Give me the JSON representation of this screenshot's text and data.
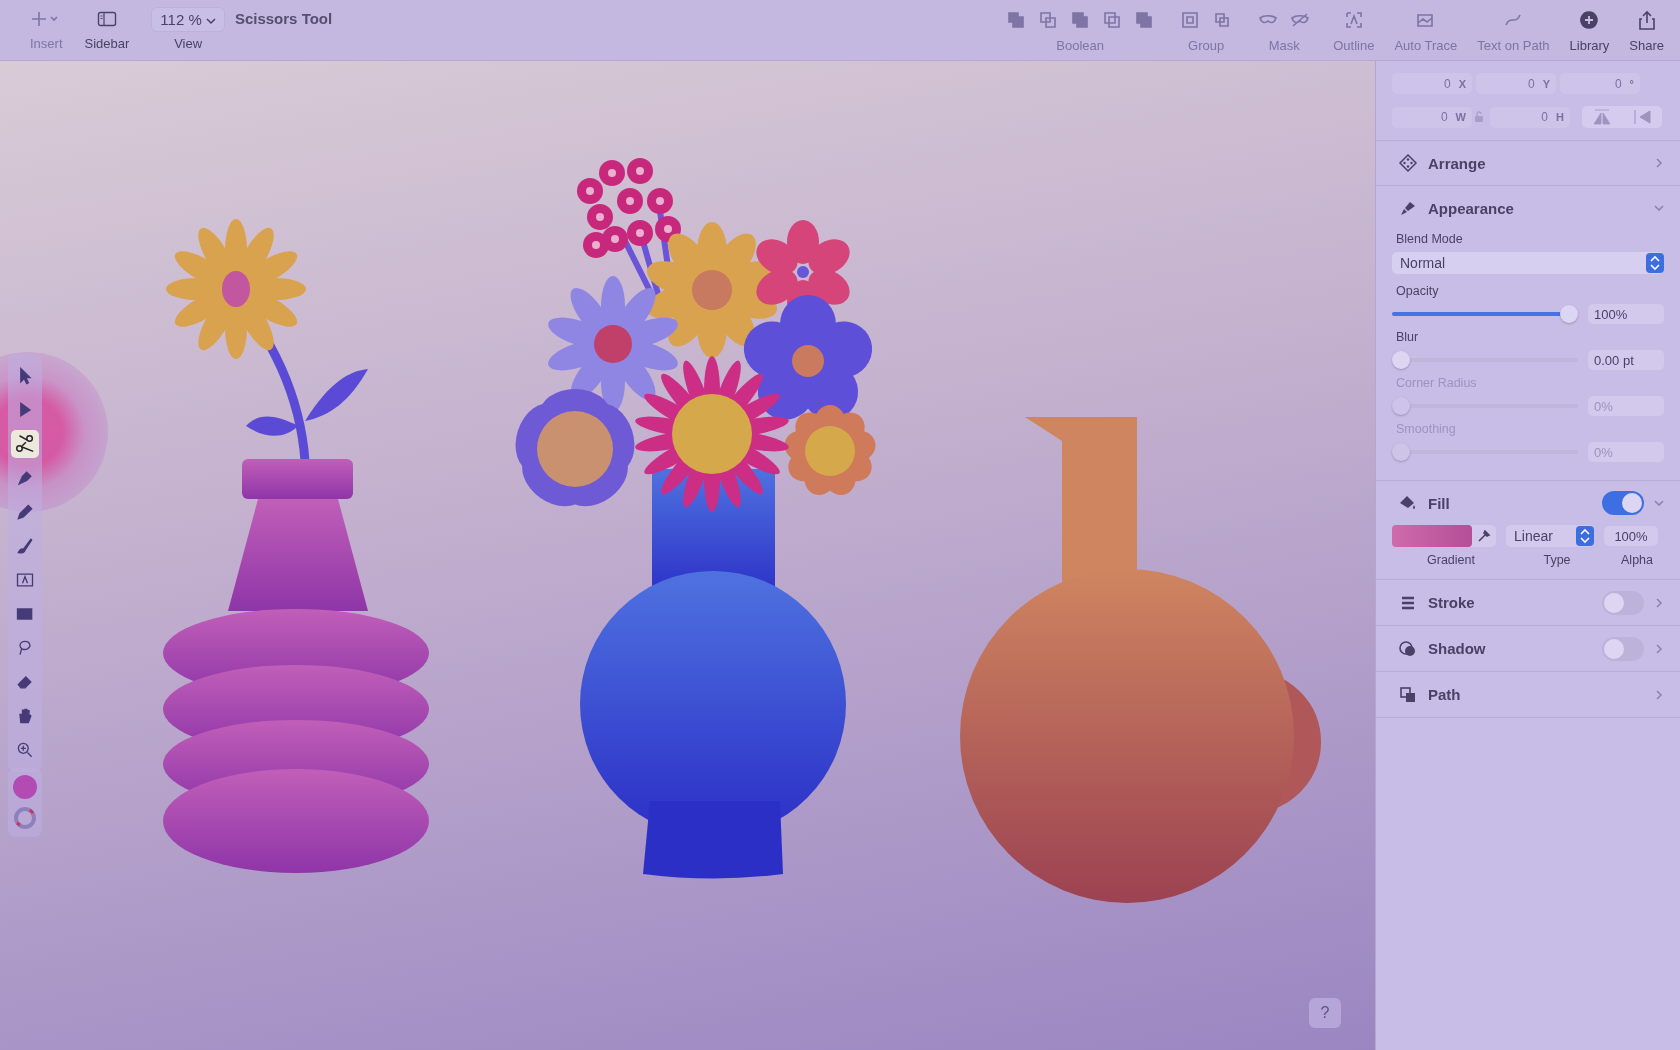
{
  "toolbar": {
    "left": [
      {
        "kind": "insert",
        "label": "Insert",
        "disabled": true
      },
      {
        "kind": "sidebar",
        "label": "Sidebar",
        "disabled": false
      }
    ],
    "zoom": {
      "value": "112 %",
      "label": "View"
    },
    "title": "Scissors Tool",
    "groups": [
      {
        "label": "Boolean",
        "icons": [
          {
            "kind": "union"
          },
          {
            "kind": "subtract"
          },
          {
            "kind": "intersect"
          },
          {
            "kind": "difference"
          },
          {
            "kind": "exclude"
          }
        ],
        "disabled": true
      },
      {
        "label": "Group",
        "icons": [
          {
            "kind": "group"
          },
          {
            "kind": "ungroup"
          }
        ],
        "disabled": true
      },
      {
        "label": "Mask",
        "icons": [
          {
            "kind": "mask"
          },
          {
            "kind": "unmask"
          }
        ],
        "disabled": true
      },
      {
        "label": "Outline",
        "icons": [
          {
            "kind": "outline"
          }
        ],
        "disabled": true
      },
      {
        "label": "Auto Trace",
        "icons": [
          {
            "kind": "trace"
          }
        ],
        "disabled": true
      },
      {
        "label": "Text on Path",
        "icons": [
          {
            "kind": "textpath"
          }
        ],
        "disabled": true
      },
      {
        "label": "Library",
        "icons": [
          {
            "kind": "library"
          }
        ],
        "disabled": false
      },
      {
        "label": "Share",
        "icons": [
          {
            "kind": "share"
          }
        ],
        "disabled": false
      }
    ]
  },
  "tools": [
    {
      "kind": "arrow",
      "selected": false
    },
    {
      "kind": "direct",
      "selected": false
    },
    {
      "kind": "scissors",
      "selected": true
    },
    {
      "kind": "pen",
      "selected": false
    },
    {
      "kind": "pencil",
      "selected": false
    },
    {
      "kind": "brush",
      "selected": false
    },
    {
      "kind": "text",
      "selected": false
    },
    {
      "kind": "rect",
      "selected": false
    },
    {
      "kind": "lasso",
      "selected": false
    },
    {
      "kind": "eraser",
      "selected": false
    },
    {
      "kind": "hand",
      "selected": false
    },
    {
      "kind": "zoom",
      "selected": false
    }
  ],
  "inspector": {
    "geometry": [
      {
        "value": "0",
        "label": "X"
      },
      {
        "value": "0",
        "label": "Y"
      },
      {
        "value": "0",
        "label": "°"
      },
      {
        "value": "0",
        "label": "W"
      },
      {
        "value": "0",
        "label": "H"
      }
    ],
    "arrange": {
      "title": "Arrange",
      "expanded": false
    },
    "appearance": {
      "title": "Appearance",
      "expanded": true,
      "blend_label": "Blend Mode",
      "blend_mode": "Normal",
      "sliders": [
        {
          "label": "Opacity",
          "level": 1,
          "reading": "100%",
          "disabled": false
        },
        {
          "label": "Blur",
          "level": 0,
          "reading": "0.00 pt",
          "disabled": false
        },
        {
          "label": "Corner Radius",
          "level": 0,
          "reading": "0%",
          "disabled": true
        },
        {
          "label": "Smoothing",
          "level": 0,
          "reading": "0%",
          "disabled": true
        }
      ]
    },
    "fill": {
      "title": "Fill",
      "on": true,
      "expanded": true,
      "type": "Linear",
      "alpha": "100%",
      "captions": [
        "Gradient",
        "Type",
        "Alpha"
      ]
    },
    "rows": [
      {
        "kind": "stroke",
        "title": "Stroke",
        "on": false
      },
      {
        "kind": "shadow",
        "title": "Shadow",
        "on": false
      },
      {
        "kind": "path",
        "title": "Path"
      }
    ]
  },
  "help": "?"
}
